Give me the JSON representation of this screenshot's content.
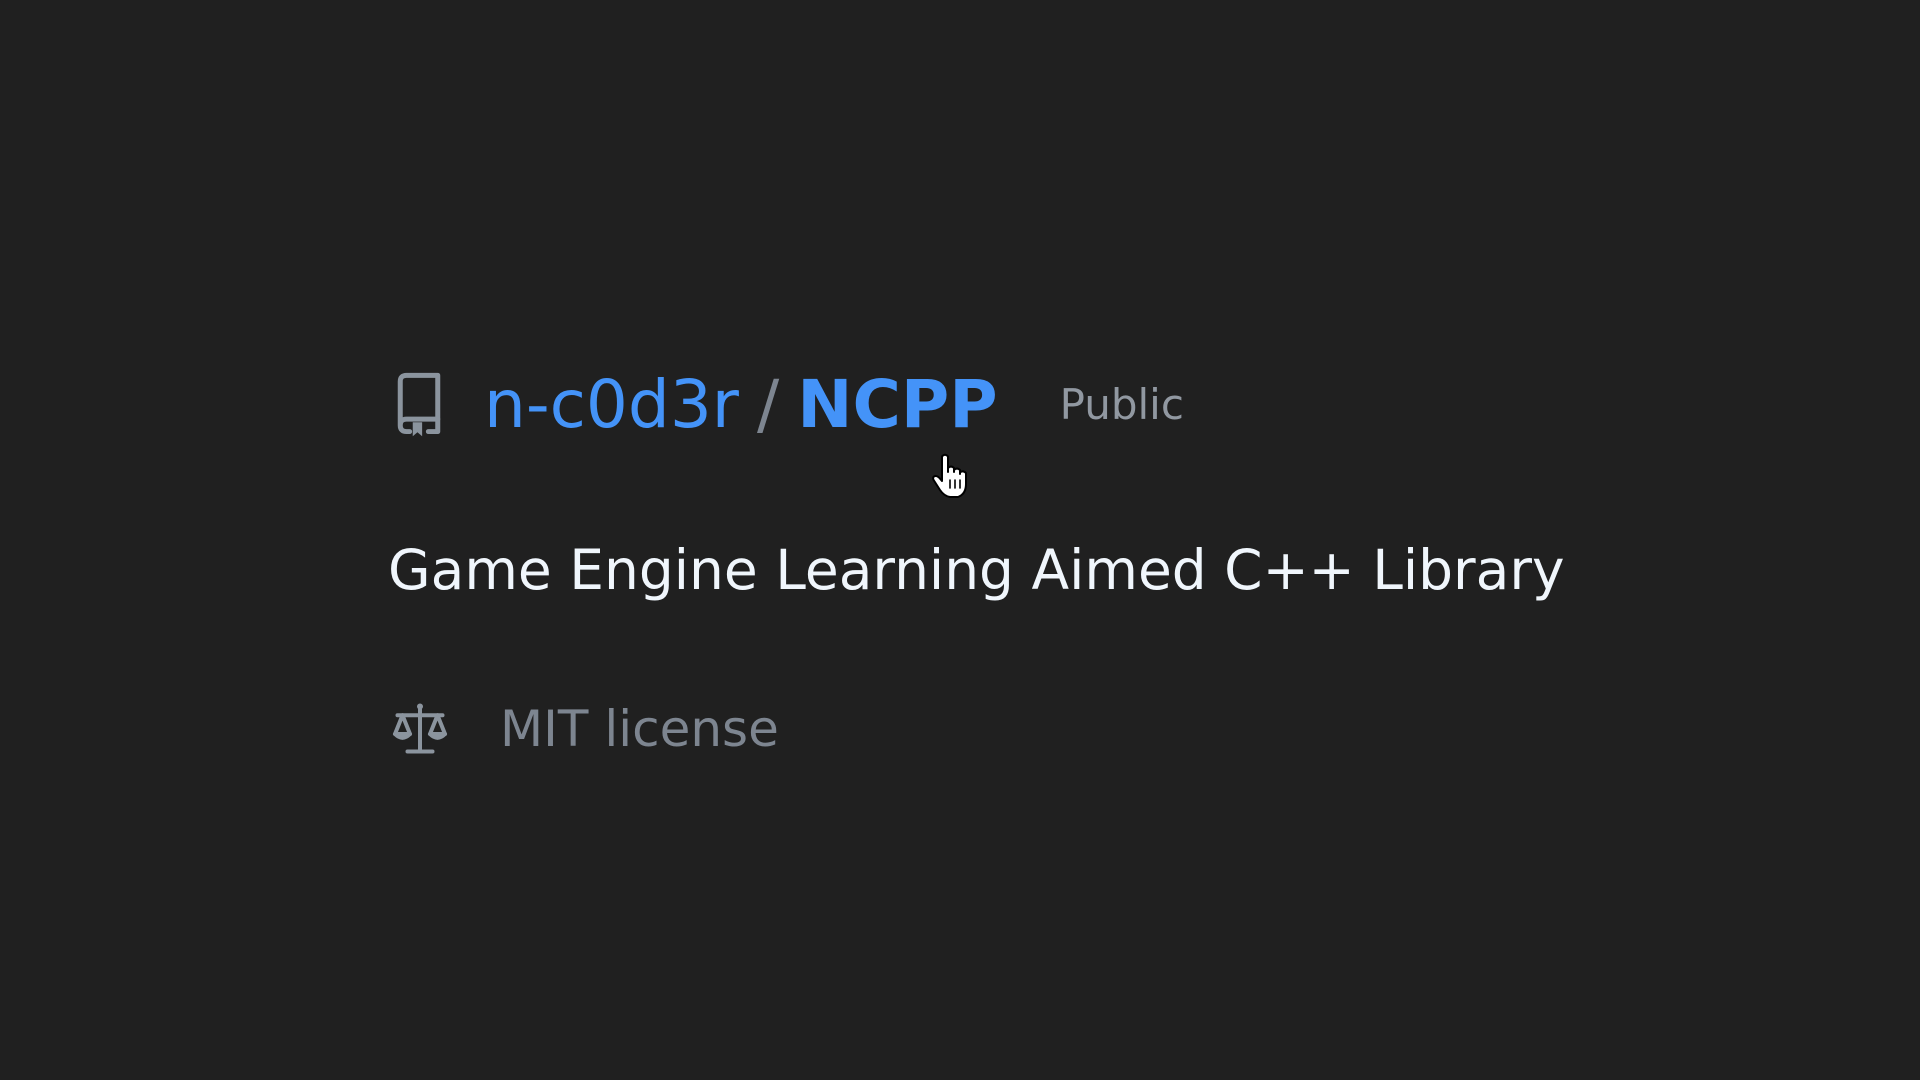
{
  "repo": {
    "owner": "n-c0d3r",
    "separator": "/",
    "name": "NCPP",
    "visibility": "Public",
    "icon": "repo-icon"
  },
  "description": "Game Engine Learning Aimed C++ Library",
  "license": {
    "label": "MIT license",
    "icon": "law-icon"
  },
  "pointer": {
    "icon": "hand-pointer-icon"
  },
  "colors": {
    "background": "#202020",
    "link": "#4493f8",
    "muted": "#7d8590",
    "text": "#f0f6fc"
  }
}
